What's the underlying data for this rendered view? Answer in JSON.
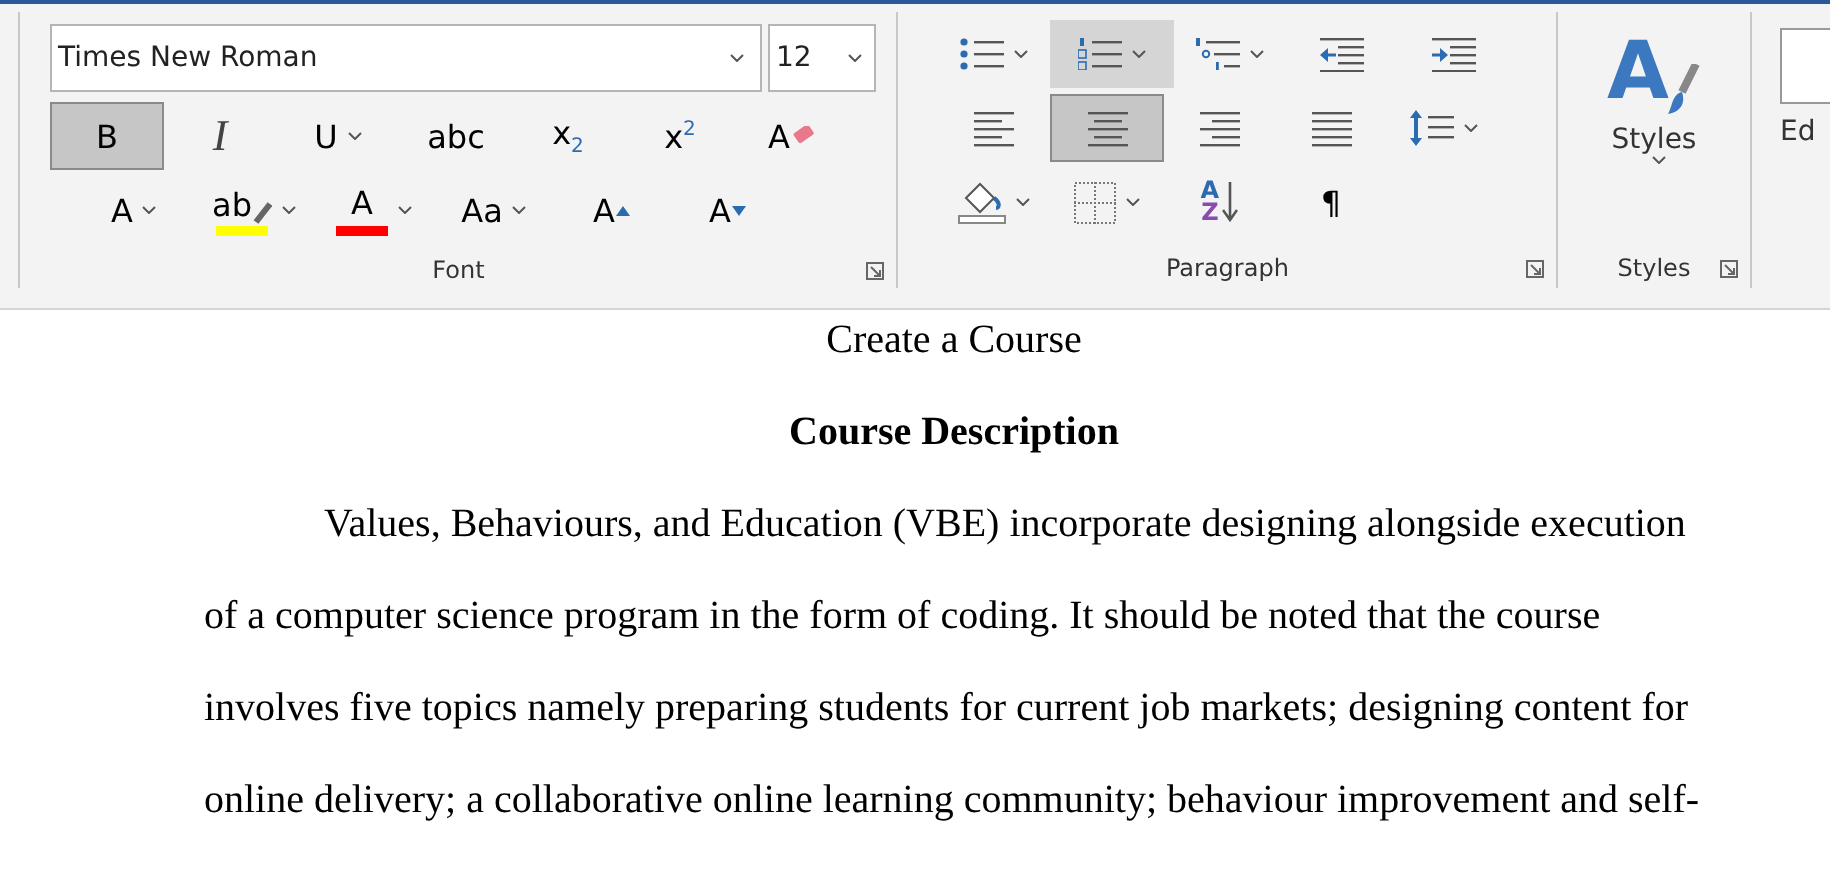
{
  "ribbon": {
    "font": {
      "label": "Font",
      "font_name": "Times New Roman",
      "font_size": "12",
      "rows": [
        [
          {
            "kind": "bold",
            "glyph": "B",
            "selected": true
          },
          {
            "kind": "italic",
            "glyph": "I",
            "selected": false
          },
          {
            "kind": "underline",
            "glyph": "U",
            "selected": false,
            "dropdown": true
          },
          {
            "kind": "strikethrough",
            "glyph": "abc",
            "selected": false
          },
          {
            "kind": "subscript",
            "glyph": "x",
            "glyph2": "2",
            "selected": false
          },
          {
            "kind": "superscript",
            "glyph": "x",
            "glyph2": "2",
            "selected": false
          },
          {
            "kind": "clear_formatting",
            "glyph": "A",
            "selected": false
          }
        ],
        [
          {
            "kind": "text_effects",
            "glyph": "A",
            "selected": false,
            "dropdown": true
          },
          {
            "kind": "highlight",
            "glyph": "ab",
            "color": "#ffff00",
            "selected": false,
            "dropdown": true
          },
          {
            "kind": "font_color",
            "glyph": "A",
            "color": "#ff0000",
            "selected": false,
            "dropdown": true
          },
          {
            "kind": "change_case",
            "glyph": "Aa",
            "selected": false,
            "dropdown": true
          },
          {
            "kind": "grow_font",
            "glyph": "A",
            "selected": false
          },
          {
            "kind": "shrink_font",
            "glyph": "A",
            "selected": false
          }
        ]
      ]
    },
    "paragraph": {
      "label": "Paragraph",
      "rows": [
        [
          {
            "kind": "bullets",
            "selected": false,
            "dropdown": true
          },
          {
            "kind": "numbering",
            "selected": true,
            "dropdown": true
          },
          {
            "kind": "multilevel",
            "selected": false,
            "dropdown": true
          },
          {
            "kind": "decrease_indent",
            "selected": false
          },
          {
            "kind": "increase_indent",
            "selected": false
          }
        ],
        [
          {
            "kind": "align_left",
            "selected": false
          },
          {
            "kind": "align_center",
            "selected": true
          },
          {
            "kind": "align_right",
            "selected": false
          },
          {
            "kind": "justify",
            "selected": false
          },
          {
            "kind": "line_spacing",
            "selected": false,
            "dropdown": true
          }
        ],
        [
          {
            "kind": "shading",
            "selected": false,
            "dropdown": true
          },
          {
            "kind": "borders",
            "selected": false,
            "dropdown": true
          },
          {
            "kind": "sort",
            "glyph": "A",
            "glyph2": "Z",
            "selected": false
          },
          {
            "kind": "show_marks",
            "glyph": "¶",
            "selected": false
          }
        ]
      ]
    },
    "styles": {
      "label": "Styles",
      "glyph": "A",
      "button_label": "Styles"
    },
    "editing": {
      "label": "Ed"
    }
  },
  "document": {
    "title": "Create a Course",
    "heading": "Course Description",
    "paragraph": "Values, Behaviours, and Education (VBE) incorporate designing alongside execution of a computer science program in the form of coding. It should be noted that the course involves five topics namely preparing students for current job markets; designing content for online delivery; a collaborative online learning community; behaviour improvement and self-"
  }
}
